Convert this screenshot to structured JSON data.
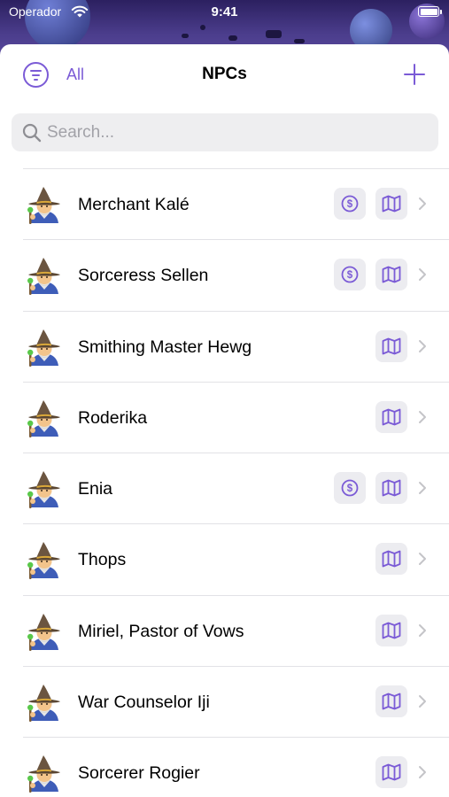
{
  "status_bar": {
    "carrier": "Operador",
    "time": "9:41"
  },
  "nav": {
    "filter_label": "All",
    "title": "NPCs"
  },
  "search": {
    "placeholder": "Search..."
  },
  "colors": {
    "accent": "#7b5bd6",
    "chip_bg": "#ececf0",
    "separator": "#e2e2e6"
  },
  "icons": {
    "filter": "line-horizontal-decrease-circle-icon",
    "add": "plus-icon",
    "search": "magnifying-glass-icon",
    "merchant": "dollar-circle-icon",
    "location": "map-icon",
    "disclosure": "chevron-right-icon",
    "avatar": "mage-emoji-icon"
  },
  "npcs": [
    {
      "name": "Merchant Kalé",
      "merchant": true
    },
    {
      "name": "Sorceress Sellen",
      "merchant": true
    },
    {
      "name": "Smithing Master Hewg",
      "merchant": false
    },
    {
      "name": "Roderika",
      "merchant": false
    },
    {
      "name": "Enia",
      "merchant": true
    },
    {
      "name": "Thops",
      "merchant": false
    },
    {
      "name": "Miriel, Pastor of Vows",
      "merchant": false
    },
    {
      "name": "War Counselor Iji",
      "merchant": false
    },
    {
      "name": "Sorcerer Rogier",
      "merchant": false
    }
  ]
}
